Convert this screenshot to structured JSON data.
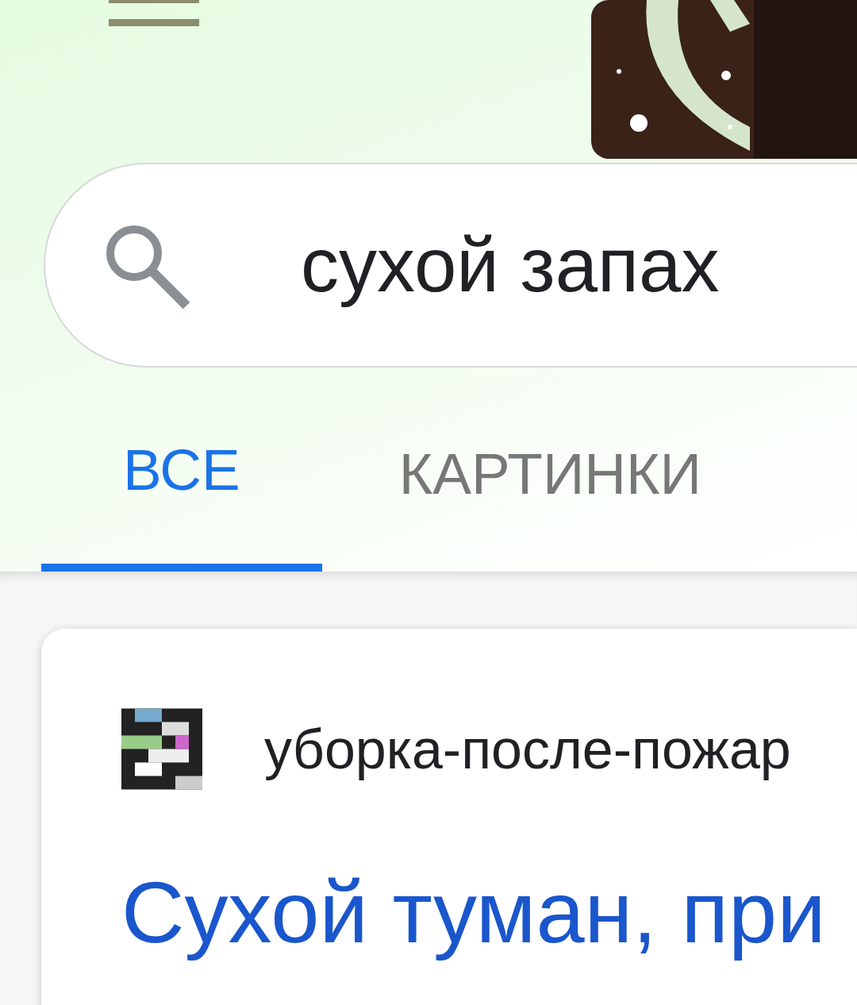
{
  "search": {
    "value": "сухой запах"
  },
  "tabs": [
    {
      "label": "ВСЕ",
      "selected": true
    },
    {
      "label": "КАРТИНКИ",
      "selected": false
    }
  ],
  "result": {
    "site": "уборка-после-пожар",
    "title": "Сухой туман, при"
  }
}
